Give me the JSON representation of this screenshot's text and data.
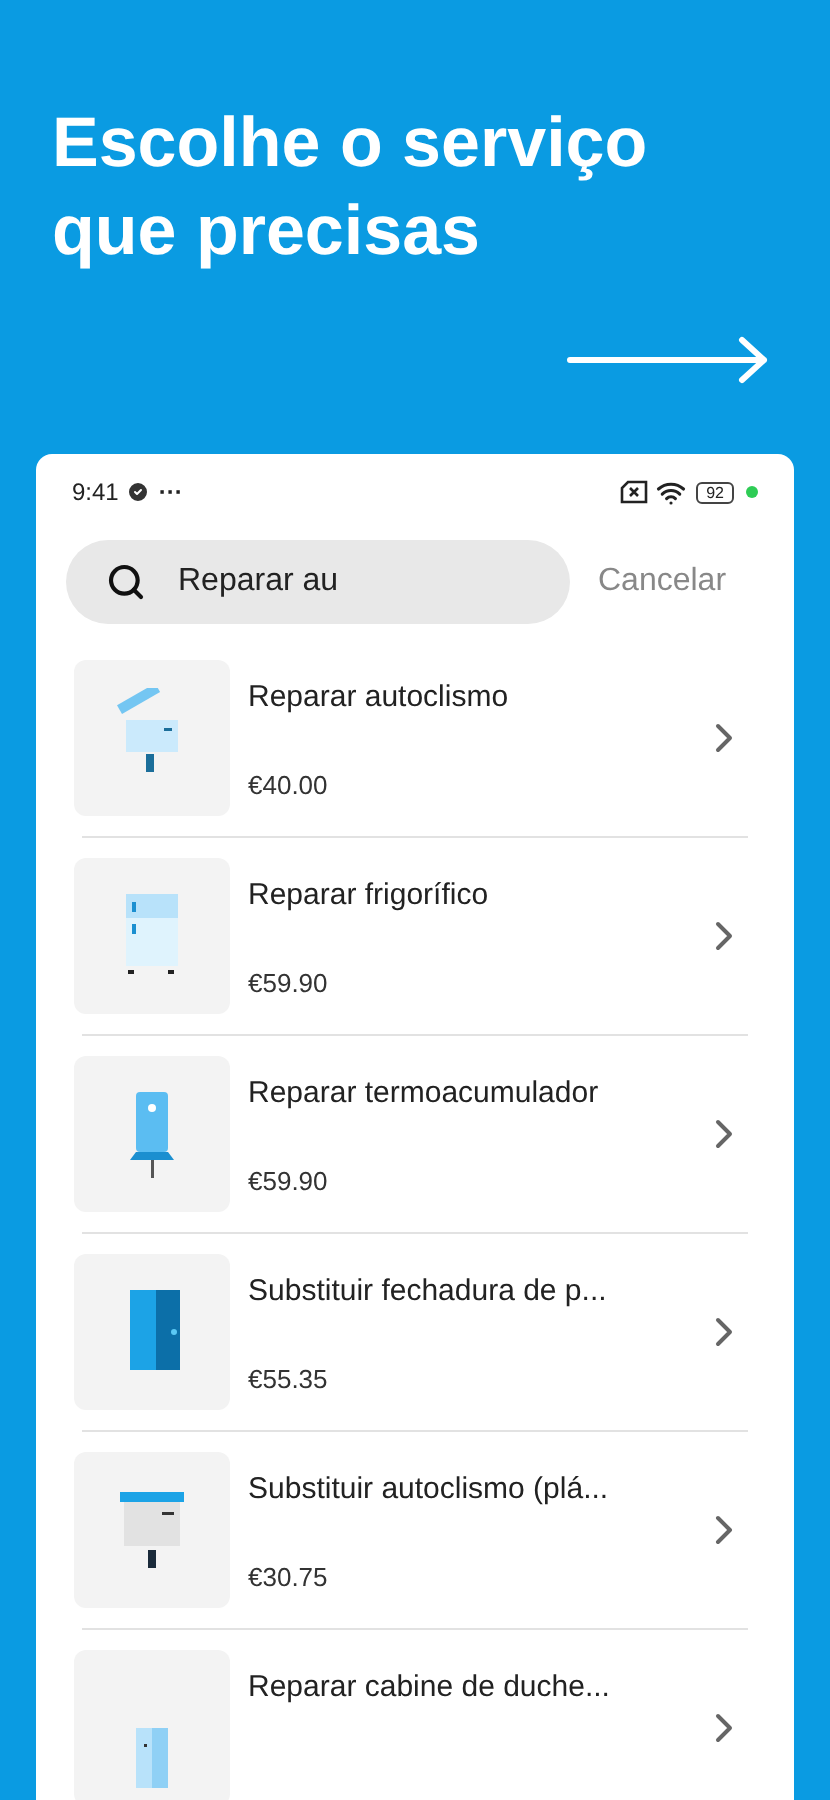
{
  "headline": "Escolhe o serviço que precisas",
  "status_bar": {
    "time": "9:41",
    "more": "···",
    "battery": "92"
  },
  "search": {
    "value": "Reparar au",
    "cancel": "Cancelar"
  },
  "results": [
    {
      "title": "Reparar autoclismo",
      "price": "€40.00"
    },
    {
      "title": "Reparar frigorífico",
      "price": "€59.90"
    },
    {
      "title": "Reparar termoacumulador",
      "price": "€59.90"
    },
    {
      "title": "Substituir fechadura de p...",
      "price": "€55.35"
    },
    {
      "title": "Substituir autoclismo (plá...",
      "price": "€30.75"
    },
    {
      "title": "Reparar cabine de duche..."
    }
  ]
}
